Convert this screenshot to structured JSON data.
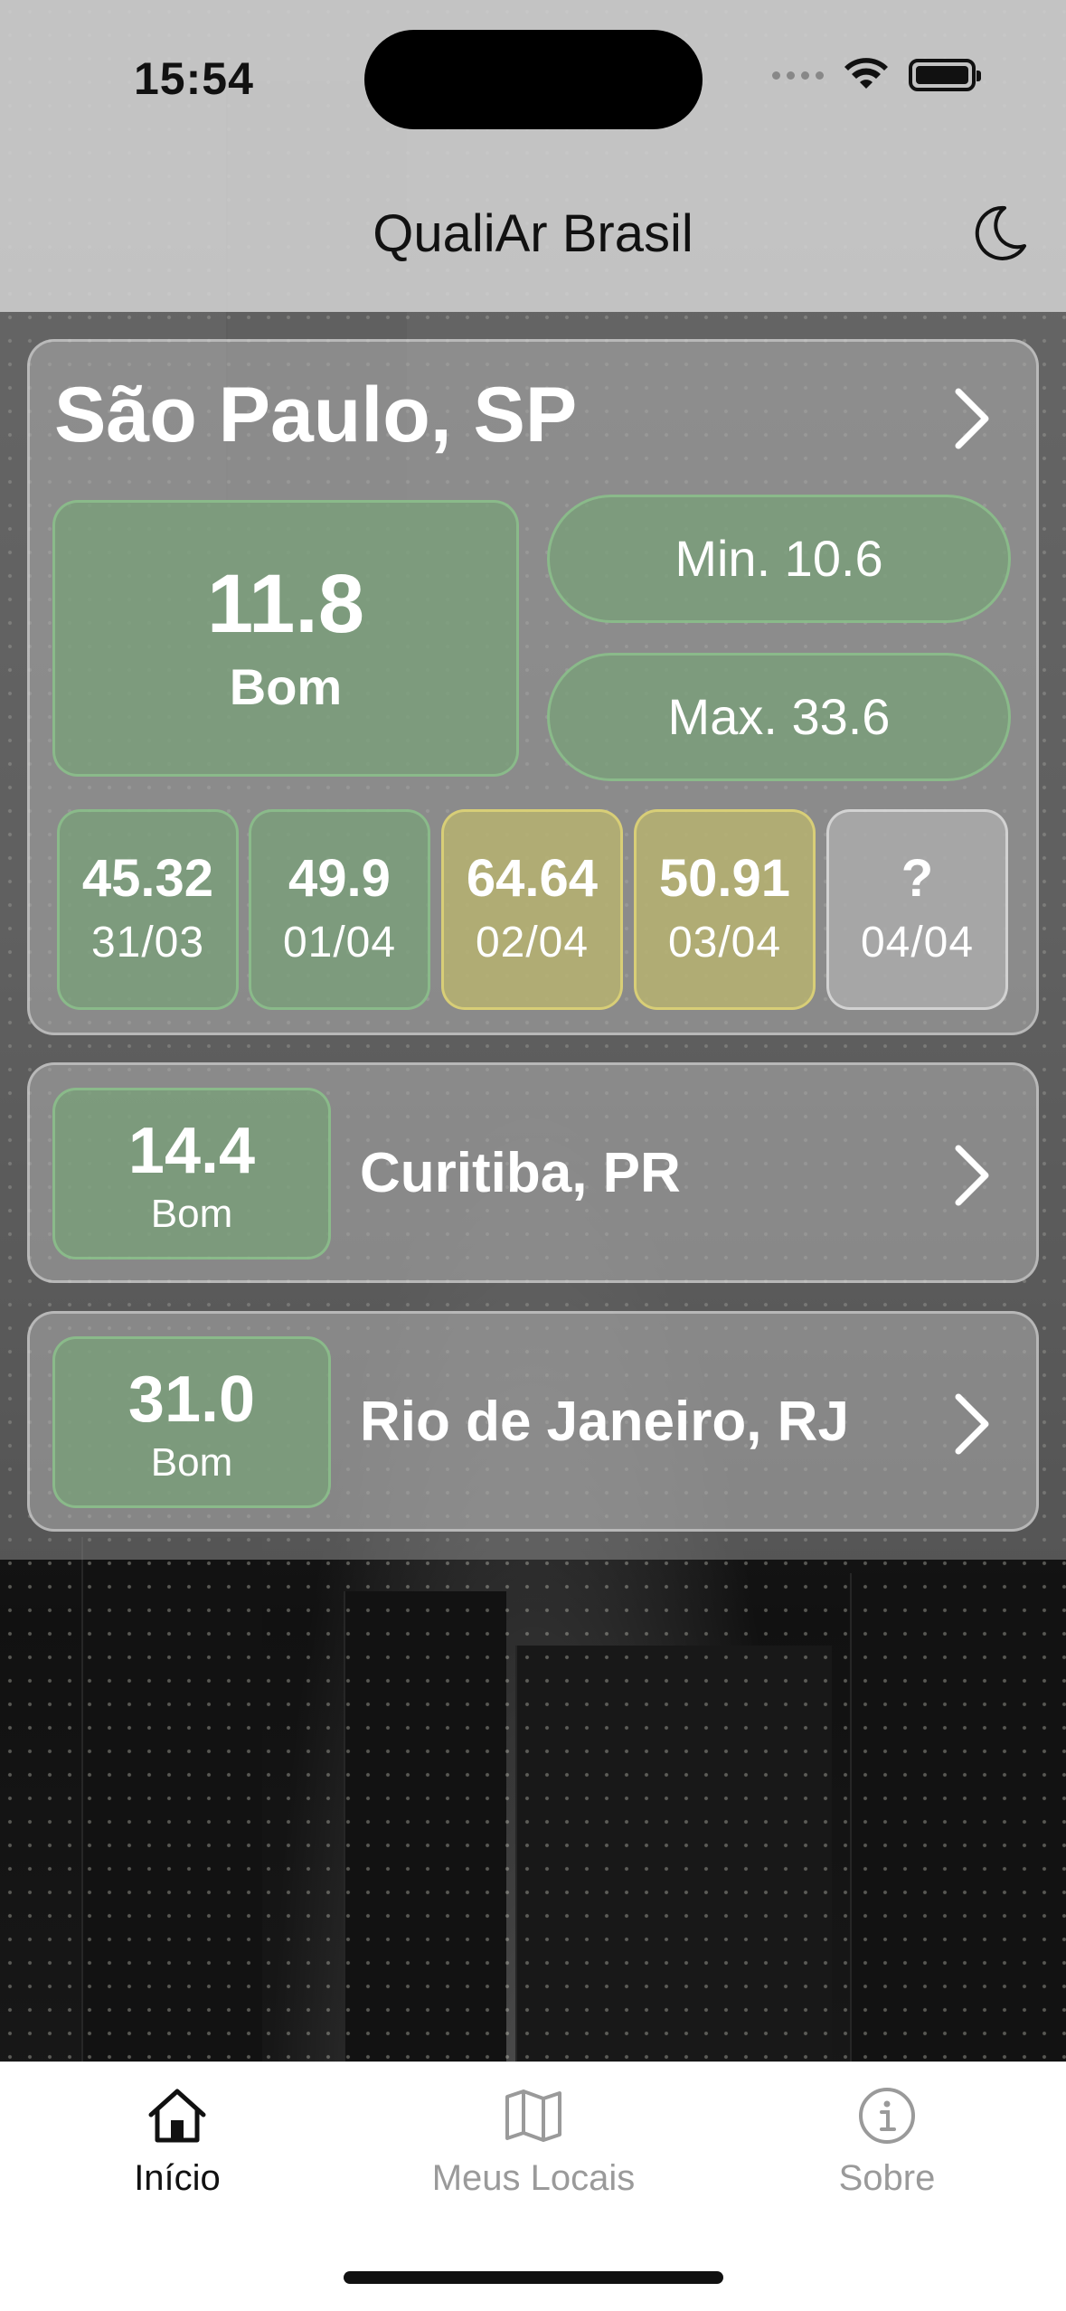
{
  "status_bar": {
    "time": "15:54"
  },
  "header": {
    "title": "QualiAr Brasil",
    "theme_icon": "moon-icon"
  },
  "main_city": {
    "name": "São Paulo, SP",
    "aqi": "11.8",
    "category": "Bom",
    "min": "Min. 10.6",
    "max": "Max. 33.6",
    "forecast": [
      {
        "value": "45.32",
        "date": "31/03",
        "level": "good"
      },
      {
        "value": "49.9",
        "date": "01/04",
        "level": "good"
      },
      {
        "value": "64.64",
        "date": "02/04",
        "level": "moderate"
      },
      {
        "value": "50.91",
        "date": "03/04",
        "level": "moderate"
      },
      {
        "value": "?",
        "date": "04/04",
        "level": "unknown"
      }
    ]
  },
  "cities": [
    {
      "aqi": "14.4",
      "category": "Bom",
      "name": "Curitiba, PR"
    },
    {
      "aqi": "31.0",
      "category": "Bom",
      "name": "Rio de Janeiro, RJ"
    }
  ],
  "tabs": [
    {
      "label": "Início",
      "icon": "home-icon",
      "active": true
    },
    {
      "label": "Meus Locais",
      "icon": "map-icon",
      "active": false
    },
    {
      "label": "Sobre",
      "icon": "info-icon",
      "active": false
    }
  ],
  "colors": {
    "good": "#78a078",
    "moderate": "#b9b46e",
    "unknown": "#afafaf",
    "tab_active": "#111111",
    "tab_inactive": "#9a9a9a"
  }
}
